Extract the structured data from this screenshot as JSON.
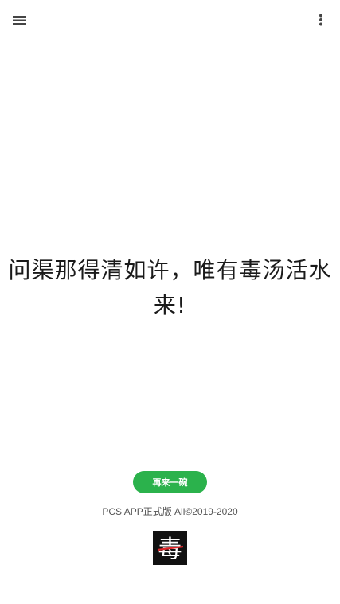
{
  "header": {
    "menu_icon": "hamburger-menu-icon",
    "more_icon": "more-vertical-icon"
  },
  "main": {
    "quote": "问渠那得清如许，唯有毒汤活水来!"
  },
  "actions": {
    "again_label": "再来一碗",
    "again_color": "#2bb24c"
  },
  "footer": {
    "copyright": "PCS APP正式版 All©2019-2020"
  },
  "logo": {
    "text": "毒"
  }
}
